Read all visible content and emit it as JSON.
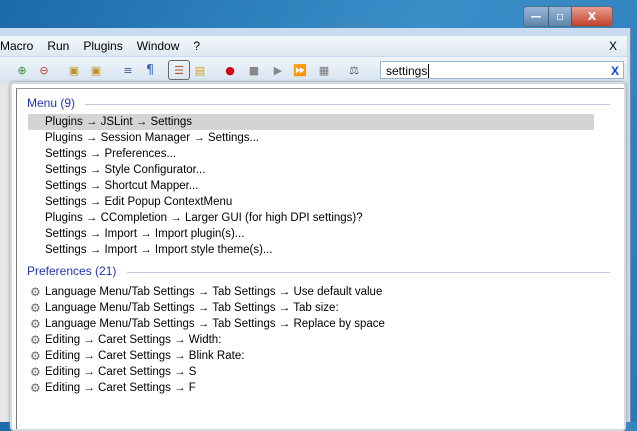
{
  "menubar": [
    "Macro",
    "Run",
    "Plugins",
    "Window",
    "?"
  ],
  "menubar_close": "X",
  "caption": {
    "minimize": "—",
    "maximize": "▫",
    "close": "X"
  },
  "search": {
    "value": "settings",
    "clear": "X"
  },
  "menu_section": {
    "title": "Menu (9)",
    "items": [
      "Plugins → JSLint → Settings",
      "Plugins → Session Manager → Settings...",
      "Settings → Preferences...",
      "Settings → Style Configurator...",
      "Settings → Shortcut Mapper...",
      "Settings → Edit Popup ContextMenu",
      "Plugins → CCompletion → Larger GUI (for high DPI settings)?",
      "Settings → Import → Import plugin(s)...",
      "Settings → Import → Import style theme(s)..."
    ]
  },
  "prefs_section": {
    "title": "Preferences (21)",
    "items": [
      "Language Menu/Tab Settings → Tab Settings → Use default value",
      "Language Menu/Tab Settings → Tab Settings → Tab size:",
      "Language Menu/Tab Settings → Tab Settings → Replace by space",
      "Editing → Caret Settings → Width:",
      "Editing → Caret Settings → Blink Rate:",
      "Editing → Caret Settings → S",
      "Editing → Caret Settings → F"
    ]
  }
}
